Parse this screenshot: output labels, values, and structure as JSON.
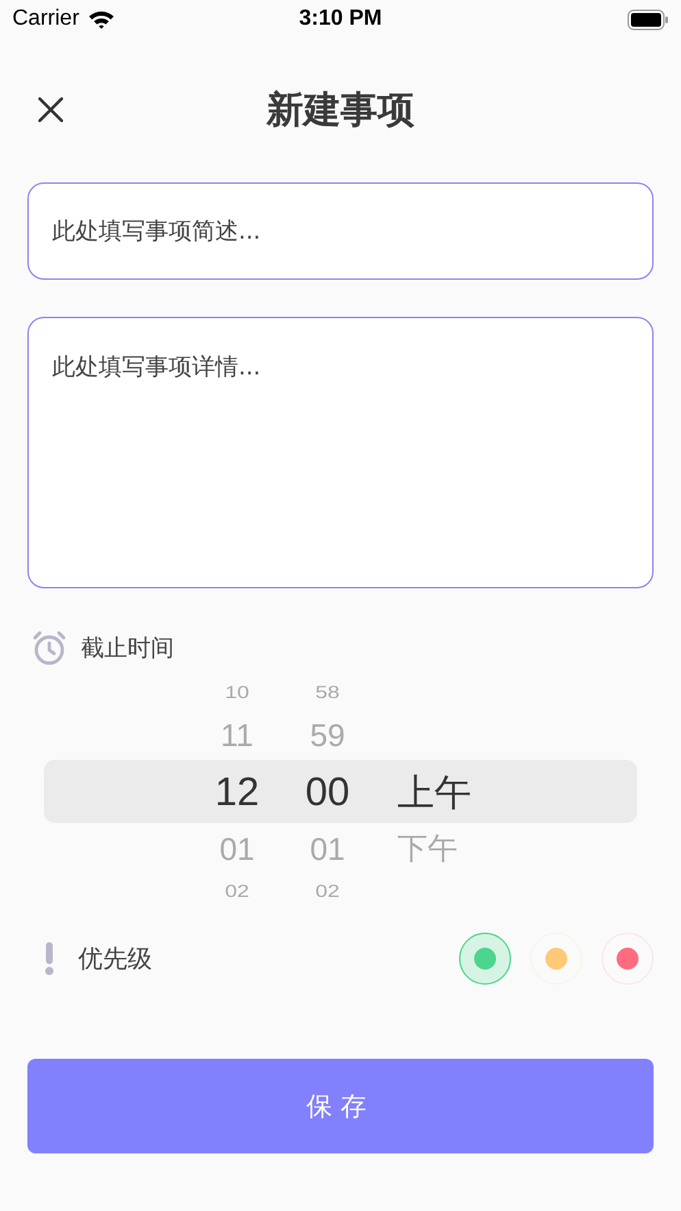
{
  "status_bar": {
    "carrier": "Carrier",
    "time": "3:10 PM"
  },
  "header": {
    "title": "新建事项"
  },
  "summary_field": {
    "placeholder": "此处填写事项简述..."
  },
  "detail_field": {
    "placeholder": "此处填写事项详情..."
  },
  "deadline": {
    "label": "截止时间"
  },
  "time_picker": {
    "rows": [
      {
        "hour": "10",
        "minute": "58",
        "selected": false
      },
      {
        "hour": "11",
        "minute": "59",
        "selected": false
      },
      {
        "hour": "12",
        "minute": "00",
        "period": "上午",
        "selected": true
      },
      {
        "hour": "01",
        "minute": "01",
        "period": "下午",
        "selected": false
      },
      {
        "hour": "02",
        "minute": "02",
        "selected": false
      }
    ]
  },
  "priority": {
    "label": "优先级",
    "options": [
      {
        "color": "#4cd68d",
        "selected": true
      },
      {
        "color": "#ffc978",
        "selected": false
      },
      {
        "color": "#ff6b81",
        "selected": false
      }
    ]
  },
  "save_button": {
    "label": "保存"
  }
}
